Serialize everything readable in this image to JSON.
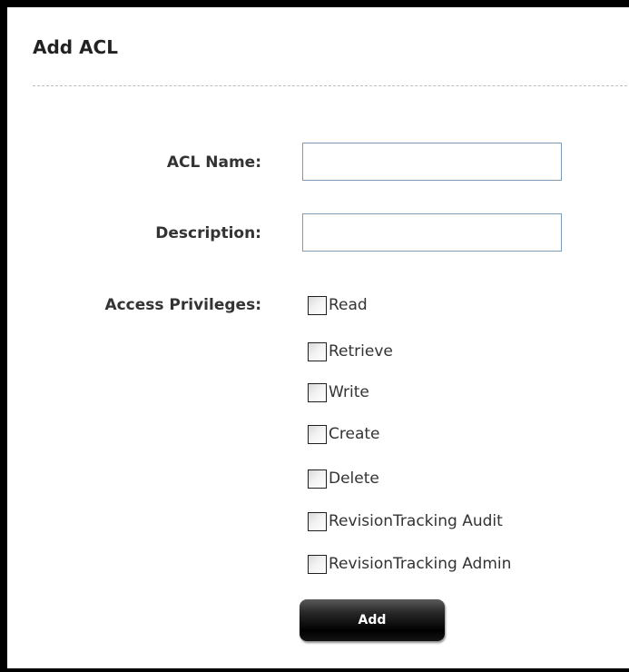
{
  "panel": {
    "title": "Add ACL"
  },
  "form": {
    "acl_name": {
      "label": "ACL Name:",
      "value": ""
    },
    "description": {
      "label": "Description:",
      "value": ""
    },
    "privileges": {
      "label": "Access Privileges:",
      "options": [
        {
          "label": "Read",
          "checked": false
        },
        {
          "label": "Retrieve",
          "checked": false
        },
        {
          "label": "Write",
          "checked": false
        },
        {
          "label": "Create",
          "checked": false
        },
        {
          "label": "Delete",
          "checked": false
        },
        {
          "label": "RevisionTracking Audit",
          "checked": false
        },
        {
          "label": "RevisionTracking Admin",
          "checked": false
        }
      ]
    },
    "add_label": "Add"
  },
  "colors": {
    "input_border": "#7d9ab5",
    "button_bg": "#000000",
    "text": "#333333"
  },
  "icons": {
    "checkbox": "checkbox-unchecked-icon"
  }
}
